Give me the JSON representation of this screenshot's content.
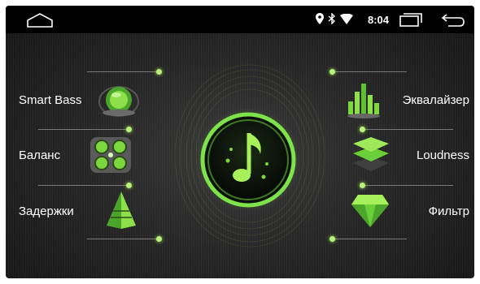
{
  "app": {
    "status_bar": {
      "time": "8:04",
      "icons": [
        "home-icon",
        "location-icon",
        "bluetooth-icon",
        "wifi-icon",
        "recent-apps-icon",
        "back-icon"
      ]
    },
    "menu": {
      "left": [
        {
          "id": "smart-bass",
          "label": "Smart Bass",
          "icon": "smart-bass-icon"
        },
        {
          "id": "balance",
          "label": "Баланс",
          "icon": "balance-icon"
        },
        {
          "id": "delays",
          "label": "Задержки",
          "icon": "delay-pyramid-icon"
        }
      ],
      "right": [
        {
          "id": "equalizer",
          "label": "Эквалайзер",
          "icon": "equalizer-icon"
        },
        {
          "id": "loudness",
          "label": "Loudness",
          "icon": "loudness-icon"
        },
        {
          "id": "filter",
          "label": "Фильтр",
          "icon": "filter-gem-icon"
        }
      ],
      "center": {
        "icon": "music-note-icon"
      }
    },
    "colors": {
      "accent": "#8ee04a",
      "background": "#262626",
      "status_bar": "#000000",
      "text": "#ffffff"
    }
  }
}
